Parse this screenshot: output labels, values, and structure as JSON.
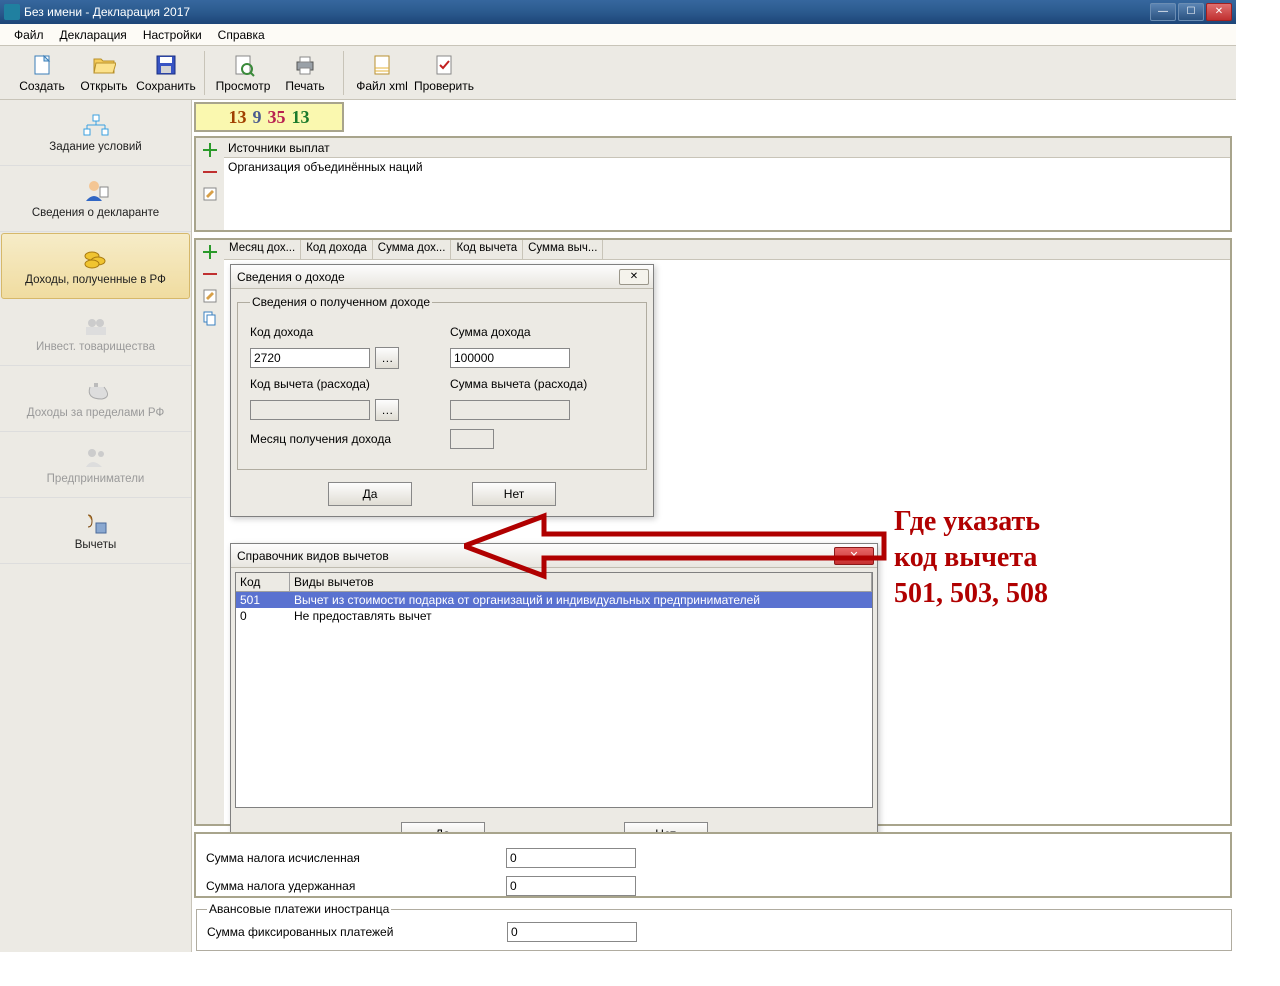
{
  "window": {
    "title": "Без имени - Декларация 2017"
  },
  "menu": {
    "file": "Файл",
    "decl": "Декларация",
    "settings": "Настройки",
    "help": "Справка"
  },
  "toolbar": {
    "create": "Создать",
    "open": "Открыть",
    "save": "Сохранить",
    "preview": "Просмотр",
    "print": "Печать",
    "xml": "Файл xml",
    "check": "Проверить"
  },
  "sidebar": {
    "item1": "Задание условий",
    "item2": "Сведения о декларанте",
    "item3": "Доходы, полученные в РФ",
    "item4": "Инвест. товарищества",
    "item5": "Доходы за пределами РФ",
    "item6": "Предприниматели",
    "item7": "Вычеты"
  },
  "header_numbers": {
    "a": "13",
    "b": "9",
    "c": "35",
    "d": "13"
  },
  "sources": {
    "header": "Источники выплат",
    "row1": "Организация объединённых наций"
  },
  "income_tabs": {
    "c1": "Месяц дох...",
    "c2": "Код дохода",
    "c3": "Сумма дох...",
    "c4": "Код вычета",
    "c5": "Сумма выч..."
  },
  "dlg_income": {
    "title": "Сведения о доходе",
    "legend": "Сведения о полученном доходе",
    "l_code": "Код дохода",
    "l_sum": "Сумма дохода",
    "v_code": "2720",
    "v_sum": "100000",
    "l_dcode": "Код вычета (расхода)",
    "l_dsum": "Сумма вычета (расхода)",
    "l_month": "Месяц получения дохода",
    "yes": "Да",
    "no": "Нет"
  },
  "dlg_ref": {
    "title": "Справочник видов вычетов",
    "col_code": "Код",
    "col_type": "Виды вычетов",
    "rows": [
      {
        "code": "501",
        "type": "Вычет из стоимости подарка от организаций и индивидуальных предпринимателей"
      },
      {
        "code": "0",
        "type": "Не предоставлять вычет"
      }
    ],
    "yes": "Да",
    "no": "Нет"
  },
  "bottom": {
    "tax_calc": "Сумма налога исчисленная",
    "tax_held": "Сумма налога удержанная",
    "val0a": "0",
    "val0b": "0",
    "adv_legend": "Авансовые платежи иностранца",
    "adv_label": "Сумма фиксированных платежей",
    "adv_val": "0"
  },
  "annotation": {
    "l1": "Где указать",
    "l2": "код вычета",
    "l3": "501, 503, 508"
  }
}
